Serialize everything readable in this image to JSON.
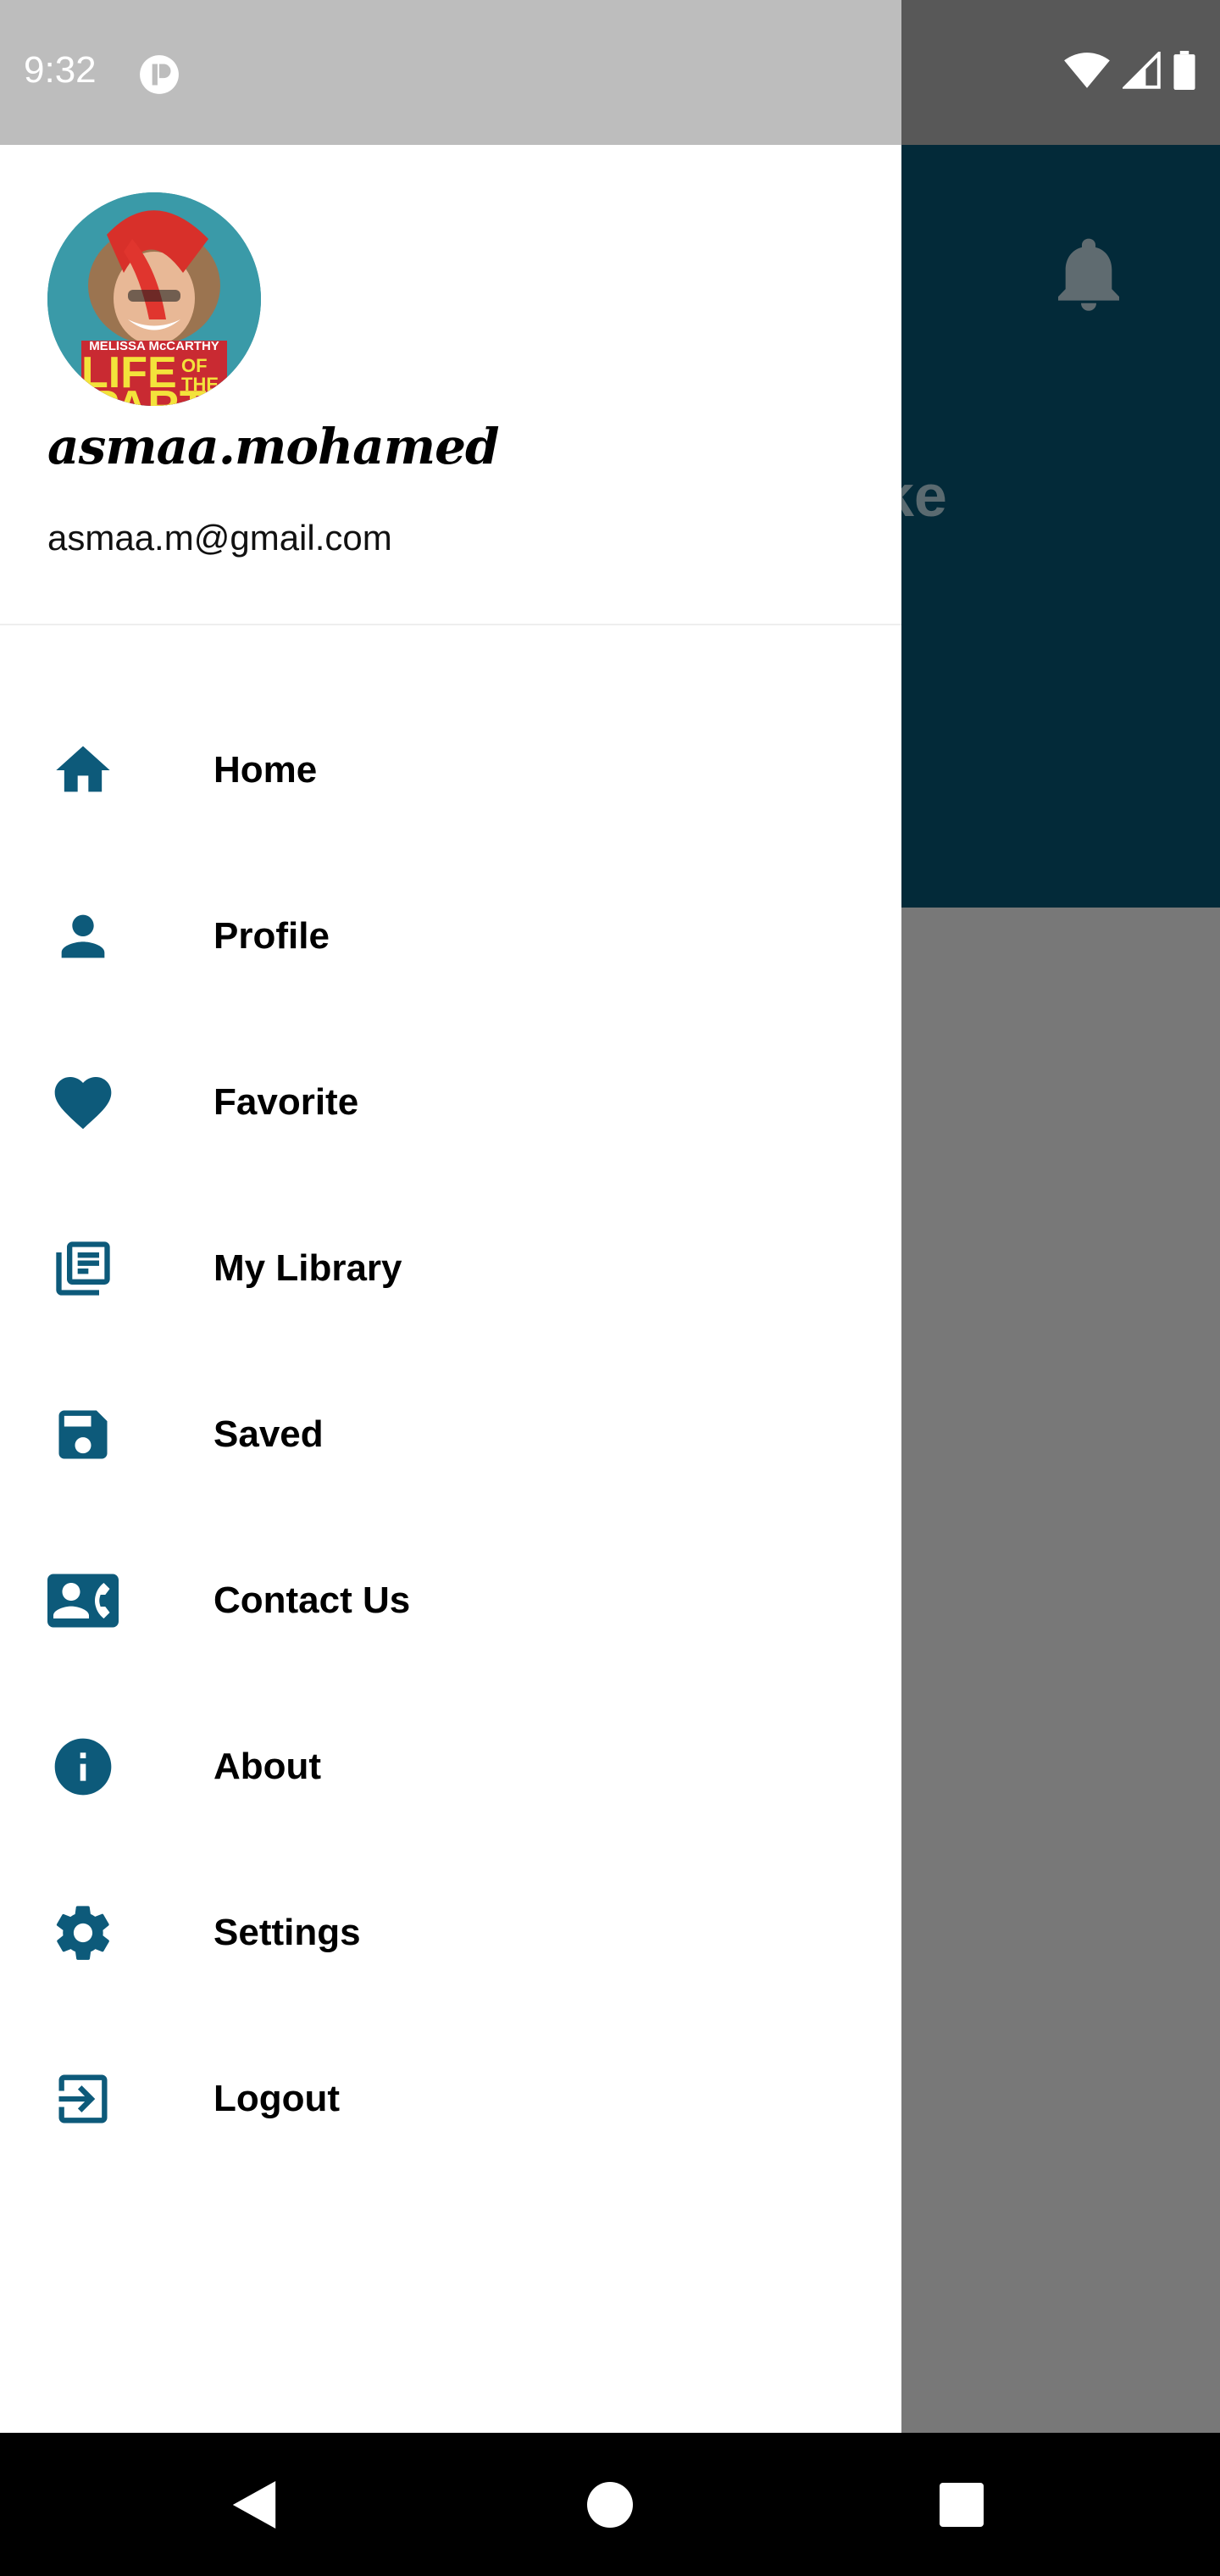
{
  "status_bar": {
    "time": "9:32"
  },
  "background": {
    "partial_title": "ke"
  },
  "drawer": {
    "username": "asmaa.mohamed",
    "email": "asmaa.m@gmail.com",
    "avatar_lettering": "MELISSA McCARTHY LIFE OF THE PARTY",
    "items": [
      {
        "label": "Home",
        "icon": "home-icon"
      },
      {
        "label": "Profile",
        "icon": "person-icon"
      },
      {
        "label": "Favorite",
        "icon": "heart-icon"
      },
      {
        "label": "My Library",
        "icon": "library-icon"
      },
      {
        "label": "Saved",
        "icon": "save-icon"
      },
      {
        "label": "Contact Us",
        "icon": "contact-phone-icon"
      },
      {
        "label": "About",
        "icon": "info-icon"
      },
      {
        "label": "Settings",
        "icon": "gear-icon"
      },
      {
        "label": "Logout",
        "icon": "logout-icon"
      }
    ]
  },
  "colors": {
    "icon": "#0d5a7a",
    "header_bg": "#032a39",
    "scrim": "#787878"
  }
}
